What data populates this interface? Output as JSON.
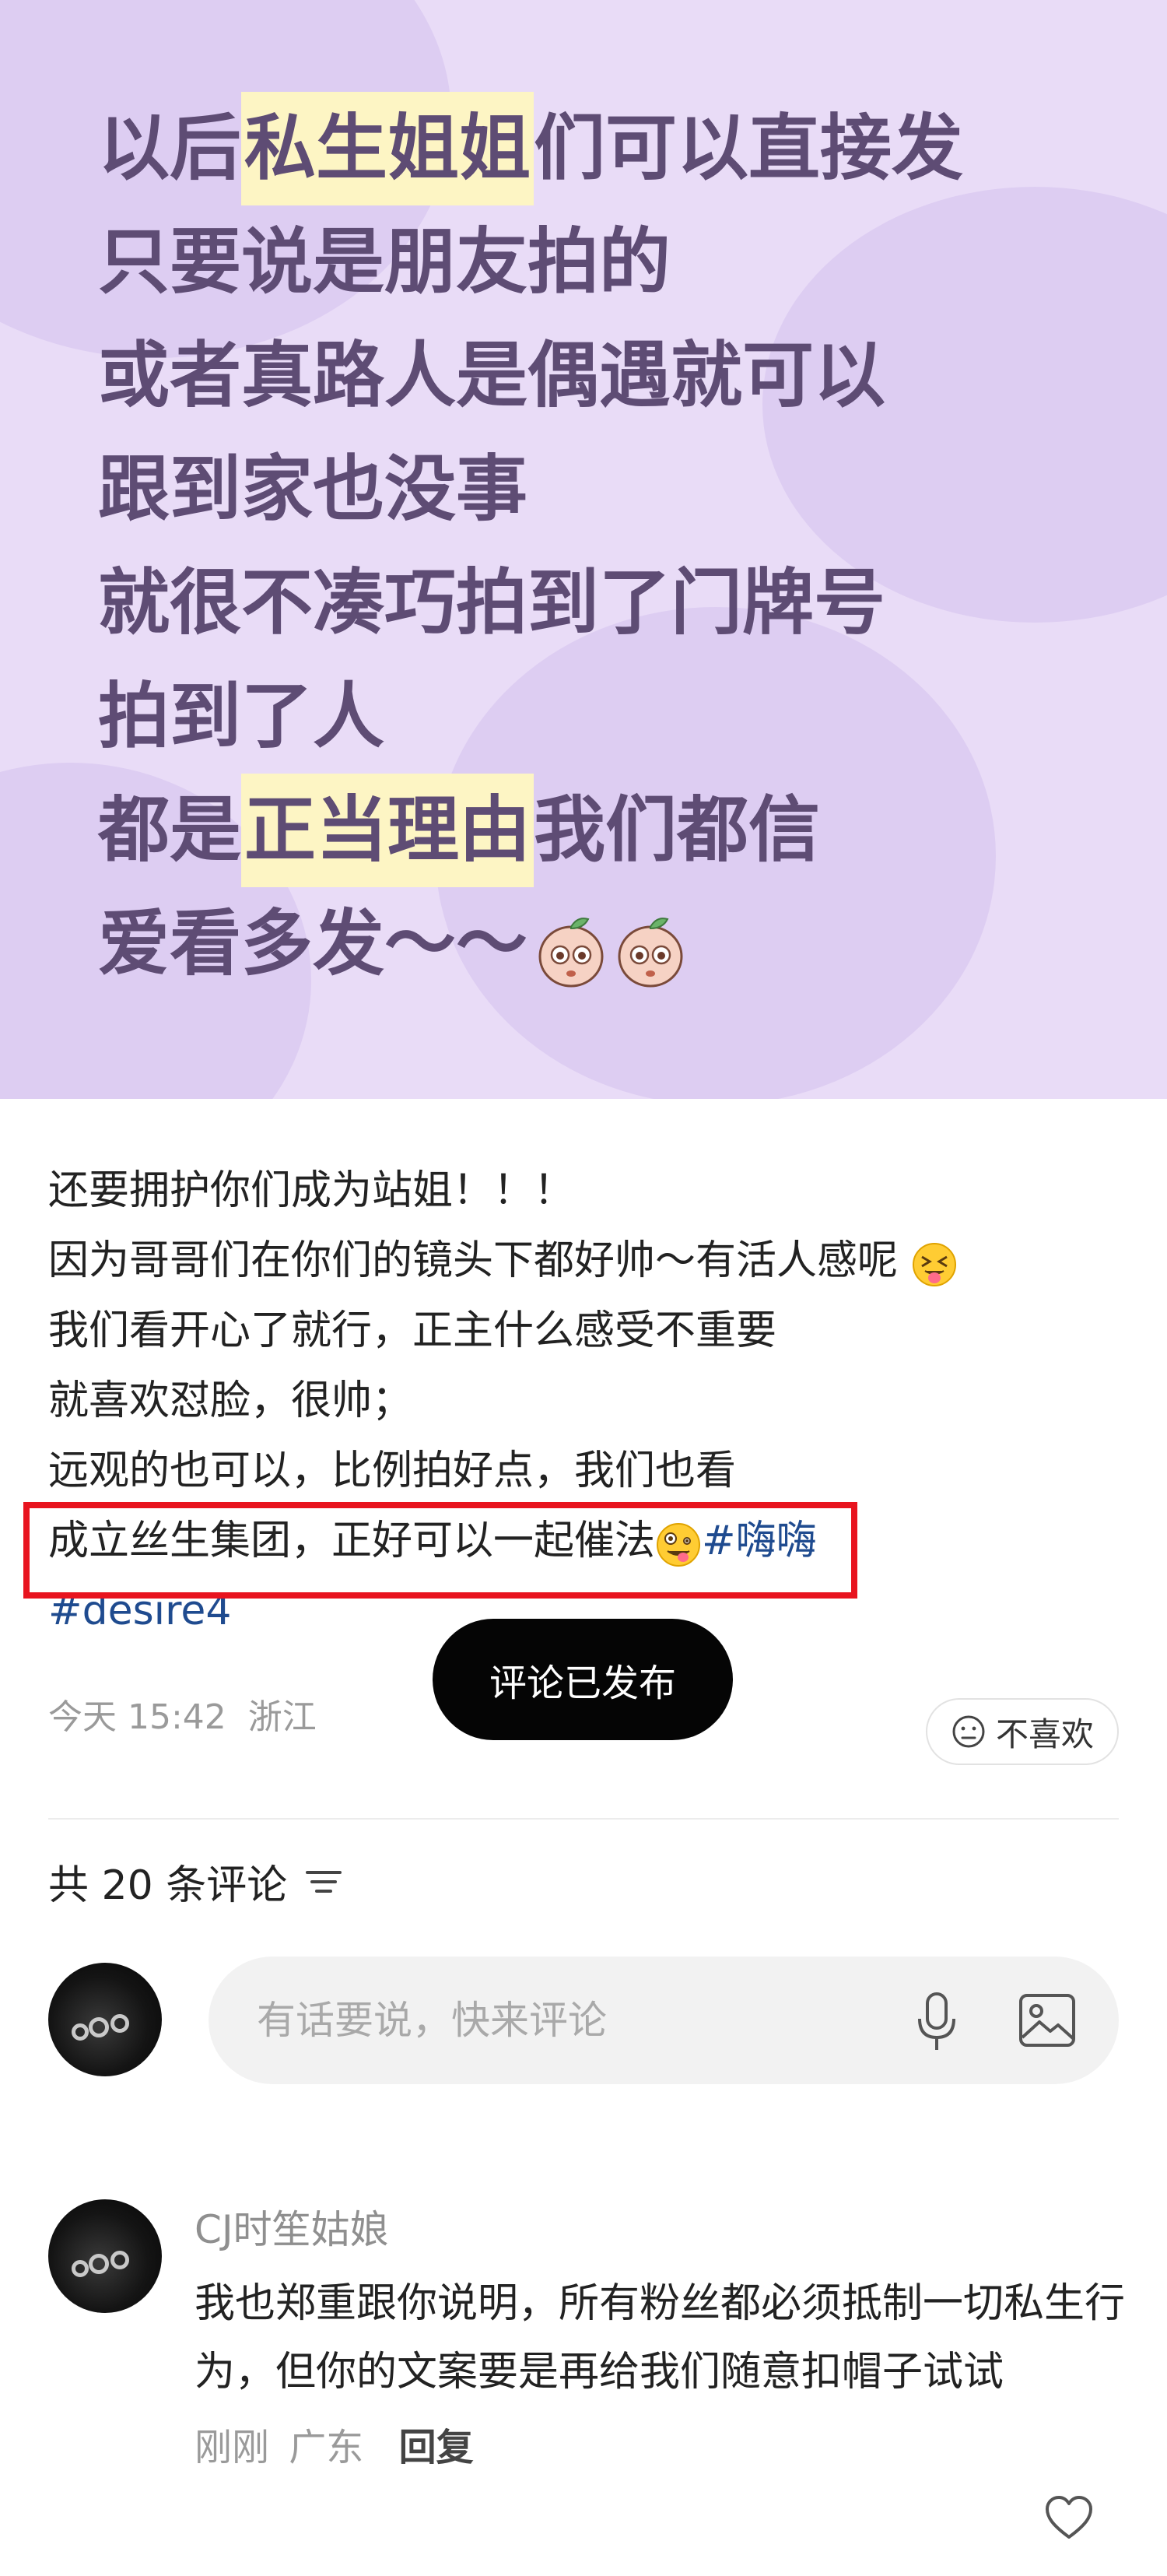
{
  "hero": {
    "lines": [
      {
        "before": "以后",
        "highlight": "私生姐姐",
        "after": "们可以直接发"
      },
      {
        "before": "只要说是朋友拍的",
        "highlight": "",
        "after": ""
      },
      {
        "before": "或者真路人是偶遇就可以",
        "highlight": "",
        "after": ""
      },
      {
        "before": "跟到家也没事",
        "highlight": "",
        "after": ""
      },
      {
        "before": "就很不凑巧拍到了门牌号",
        "highlight": "",
        "after": ""
      },
      {
        "before": "拍到了人",
        "highlight": "",
        "after": ""
      },
      {
        "before": "都是",
        "highlight": "正当理由",
        "after": "我们都信"
      },
      {
        "before": "爱看多发～～",
        "highlight": "",
        "after": ""
      }
    ]
  },
  "post": {
    "line1": "还要拥护你们成为站姐！！！",
    "line2": "因为哥哥们在你们的镜头下都好帅～有活人感呢",
    "line3": "我们看开心了就行，正主什么感受不重要",
    "line4": "就喜欢怼脸，很帅；",
    "line5": "远观的也可以，比例拍好点，我们也看",
    "line6": "成立丝生集团，正好可以一起催法",
    "tag1": "#嗨嗨",
    "tag2": "#desire4",
    "time": "今天 15:42",
    "location": "浙江"
  },
  "toast": "评论已发布",
  "dislike_label": "不喜欢",
  "comments_header": "共 20 条评论",
  "input_placeholder": "有话要说，快来评论",
  "comment": {
    "user": "CJ时笙姑娘",
    "text": "我也郑重跟你说明，所有粉丝都必须抵制一切私生行为，但你的文案要是再给我们随意扣帽子试试",
    "time": "刚刚",
    "location": "广东",
    "reply_label": "回复"
  },
  "colors": {
    "hero_bg": "#e9dcf7",
    "hero_text": "#5e4c74",
    "highlight": "#fdf5c4",
    "tag": "#1f4b8f",
    "red_box": "#e8141f"
  }
}
